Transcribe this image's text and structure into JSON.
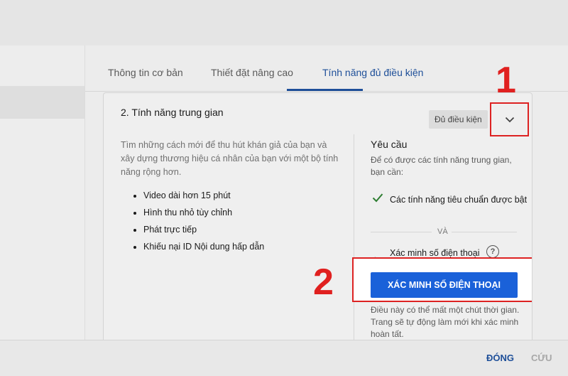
{
  "tabs": [
    {
      "label": "Thông tin cơ bản",
      "active": false
    },
    {
      "label": "Thiết đặt nâng cao",
      "active": false
    },
    {
      "label": "Tính năng đủ điều kiện",
      "active": true
    }
  ],
  "section": {
    "title": "2. Tính năng trung gian",
    "status_badge": "Đủ điều kiện",
    "description": "Tìm những cách mới để thu hút khán giả của bạn và xây dựng thương hiệu cá nhân của bạn với một bộ tính năng rộng hơn.",
    "features": [
      "Video dài hơn 15 phút",
      "Hình thu nhỏ tùy chỉnh",
      "Phát trực tiếp",
      "Khiếu nại ID Nội dung hấp dẫn"
    ]
  },
  "requirements": {
    "title": "Yêu cầu",
    "subtitle": "Để có được các tính năng trung gian, bạn cần:",
    "item_met": "Các tính năng tiêu chuẩn được bật",
    "or_separator": "VÀ",
    "item_pending": "Xác minh số điện thoại",
    "verify_button": "XÁC MINH SỐ ĐIỆN THOẠI",
    "note": "Điều này có thể mất một chút thời gian. Trang sẽ tự động làm mới khi xác minh hoàn tất."
  },
  "annotations": {
    "step1": "1",
    "step2": "2"
  },
  "footer": {
    "close_label": "ĐÓNG",
    "save_label": "CỨU"
  },
  "colors": {
    "accent": "#1e4f99",
    "button": "#1a61d9",
    "check": "#2e7d32",
    "annotation": "#dd2222"
  }
}
